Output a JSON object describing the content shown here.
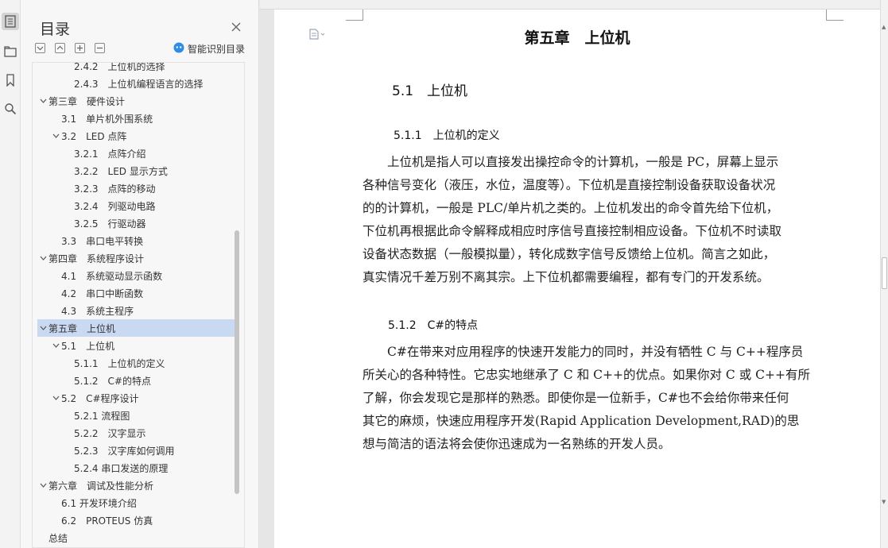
{
  "nav": {
    "title": "目录",
    "smart_label": "智能识别目录",
    "items": [
      {
        "label": "2.4.2　上位机的选择",
        "level": 3,
        "caret": "",
        "selected": false
      },
      {
        "label": "2.4.3　上位机编程语言的选择",
        "level": 3,
        "caret": "",
        "selected": false
      },
      {
        "label": "第三章　硬件设计",
        "level": 1,
        "caret": "v",
        "selected": false
      },
      {
        "label": "3.1　单片机外围系统",
        "level": 2,
        "caret": "",
        "selected": false
      },
      {
        "label": "3.2　LED 点阵",
        "level": 2,
        "caret": "v",
        "selected": false
      },
      {
        "label": "3.2.1　点阵介绍",
        "level": 3,
        "caret": "",
        "selected": false
      },
      {
        "label": "3.2.2　LED 显示方式",
        "level": 3,
        "caret": "",
        "selected": false
      },
      {
        "label": "3.2.3　点阵的移动",
        "level": 3,
        "caret": "",
        "selected": false
      },
      {
        "label": "3.2.4　列驱动电路",
        "level": 3,
        "caret": "",
        "selected": false
      },
      {
        "label": "3.2.5　行驱动器",
        "level": 3,
        "caret": "",
        "selected": false
      },
      {
        "label": "3.3　串口电平转换",
        "level": 2,
        "caret": "",
        "selected": false
      },
      {
        "label": "第四章　系统程序设计",
        "level": 1,
        "caret": "v",
        "selected": false
      },
      {
        "label": "4.1　系统驱动显示函数",
        "level": 2,
        "caret": "",
        "selected": false
      },
      {
        "label": "4.2　串口中断函数",
        "level": 2,
        "caret": "",
        "selected": false
      },
      {
        "label": "4.3　系统主程序",
        "level": 2,
        "caret": "",
        "selected": false
      },
      {
        "label": "第五章　上位机",
        "level": 1,
        "caret": "v",
        "selected": true
      },
      {
        "label": "5.1　上位机",
        "level": 2,
        "caret": "v",
        "selected": false
      },
      {
        "label": "5.1.1　上位机的定义",
        "level": 3,
        "caret": "",
        "selected": false
      },
      {
        "label": "5.1.2　C#的特点",
        "level": 3,
        "caret": "",
        "selected": false
      },
      {
        "label": "5.2　C#程序设计",
        "level": 2,
        "caret": "v",
        "selected": false
      },
      {
        "label": "5.2.1 流程图",
        "level": 3,
        "caret": "",
        "selected": false
      },
      {
        "label": "5.2.2　汉字显示",
        "level": 3,
        "caret": "",
        "selected": false
      },
      {
        "label": "5.2.3　汉字库如何调用",
        "level": 3,
        "caret": "",
        "selected": false
      },
      {
        "label": "5.2.4 串口发送的原理",
        "level": 3,
        "caret": "",
        "selected": false
      },
      {
        "label": "第六章　调试及性能分析",
        "level": 1,
        "caret": "v",
        "selected": false
      },
      {
        "label": "6.1 开发环境介绍",
        "level": 2,
        "caret": "",
        "selected": false
      },
      {
        "label": "6.2　PROTEUS 仿真",
        "level": 2,
        "caret": "",
        "selected": false
      },
      {
        "label": "总结",
        "level": 1,
        "caret": "",
        "selected": false
      }
    ]
  },
  "doc": {
    "chapter_title": "第五章　上位机",
    "section_title": "5.1　上位机",
    "sub1_title": "5.1.1　上位机的定义",
    "para1_lines": [
      "　　上位机是指人可以直接发出操控命令的计算机，一般是 PC，屏幕上显示",
      "各种信号变化（液压，水位，温度等）。下位机是直接控制设备获取设备状况",
      "的的计算机，一般是 PLC/单片机之类的。上位机发出的命令首先给下位机，",
      "下位机再根据此命令解释成相应时序信号直接控制相应设备。下位机不时读取",
      "设备状态数据（一般模拟量），转化成数字信号反馈给上位机。简言之如此，",
      "真实情况千差万别不离其宗。上下位机都需要编程，都有专门的开发系统。"
    ],
    "sub2_title": "5.1.2　C#的特点",
    "para2_lines": [
      "　　C#在带来对应用程序的快速开发能力的同时，并没有牺牲 C 与 C++程序员",
      "所关心的各种特性。它忠实地继承了 C 和 C++的优点。如果你对 C 或 C++有所",
      "了解，你会发现它是那样的熟悉。即使你是一位新手，C#也不会给你带来任何",
      "其它的麻烦，快速应用程序开发(Rapid Application Development,RAD)的思",
      "想与简洁的语法将会使你迅速成为一名熟练的开发人员。"
    ]
  },
  "icons": {
    "rail": [
      "toc-icon",
      "folder-tree-icon",
      "bookmark-icon",
      "search-icon"
    ],
    "accent": "#c9d9f2",
    "smart_icon_color": "#2e8ce6"
  }
}
